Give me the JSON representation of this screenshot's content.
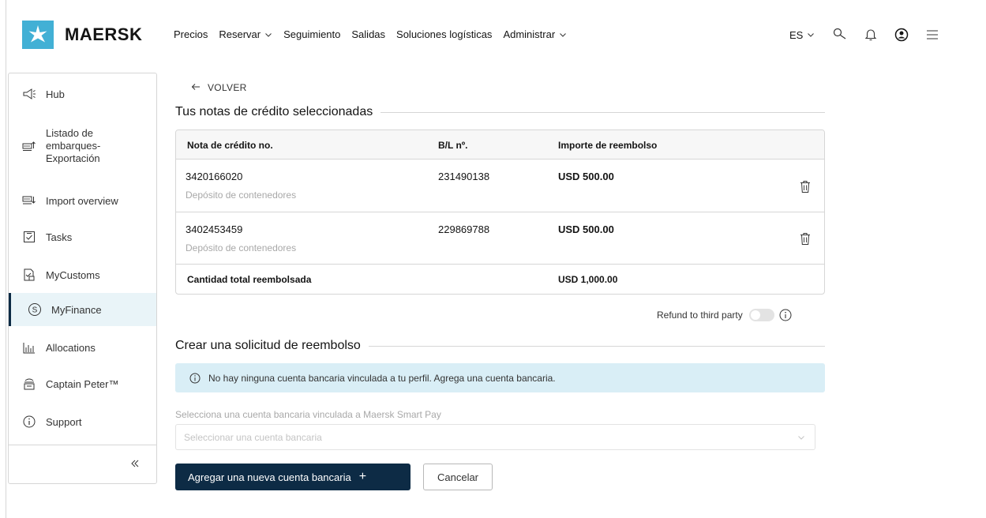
{
  "brand": {
    "name": "MAERSK",
    "logo_color": "#42b0d5"
  },
  "nav": {
    "items": [
      {
        "label": "Precios",
        "dropdown": false
      },
      {
        "label": "Reservar",
        "dropdown": true
      },
      {
        "label": "Seguimiento",
        "dropdown": false
      },
      {
        "label": "Salidas",
        "dropdown": false
      },
      {
        "label": "Soluciones logísticas",
        "dropdown": false
      },
      {
        "label": "Administrar",
        "dropdown": true
      }
    ],
    "language": "ES",
    "icons": [
      "search-icon",
      "bell-icon",
      "user-icon",
      "menu-icon"
    ]
  },
  "sidebar": {
    "items": [
      {
        "label": "Hub",
        "icon": "megaphone-icon"
      },
      {
        "label": "Listado de embarques-Exportación",
        "lines": [
          "Listado de",
          "embarques-",
          "Exportación"
        ],
        "icon": "export-icon"
      },
      {
        "label": "Import overview",
        "icon": "import-icon"
      },
      {
        "label": "Tasks",
        "icon": "checkbox-icon"
      },
      {
        "label": "MyCustoms",
        "icon": "customs-icon"
      },
      {
        "label": "MyFinance",
        "icon": "finance-icon",
        "active": true
      },
      {
        "label": "Allocations",
        "icon": "bar-chart-icon"
      },
      {
        "label": "Captain Peter™",
        "icon": "captain-icon"
      },
      {
        "label": "Support",
        "icon": "info-icon"
      }
    ],
    "collapse_icon": "double-chevron-left-icon",
    "active_color": "#0d2b45"
  },
  "main": {
    "back_label": "VOLVER",
    "selected_title": "Tus notas de crédito seleccionadas",
    "table": {
      "headers": [
        "Nota de crédito no.",
        "B/L nº.",
        "Importe de reembolso"
      ],
      "rows": [
        {
          "credit_note": "3420166020",
          "description": "Depósito de contenedores",
          "bl": "231490138",
          "amount": "USD 500.00"
        },
        {
          "credit_note": "3402453459",
          "description": "Depósito de contenedores",
          "bl": "229869788",
          "amount": "USD 500.00"
        }
      ],
      "total_label": "Cantidad total reembolsada",
      "total_amount": "USD 1,000.00"
    },
    "refund_third_party_label": "Refund to third party",
    "refund_third_party_on": false,
    "request_title": "Crear una solicitud de reembolso",
    "alert_text": "No hay ninguna cuenta bancaria vinculada a tu perfil. Agrega una cuenta bancaria.",
    "bank_field_label": "Selecciona una cuenta bancaria vinculada a Maersk Smart Pay",
    "bank_select_placeholder": "Seleccionar una cuenta bancaria",
    "add_account_button": "Agregar una nueva cuenta bancaria",
    "cancel_button": "Cancelar",
    "primary_color": "#0d2b45",
    "alert_color": "#d9eef6"
  }
}
